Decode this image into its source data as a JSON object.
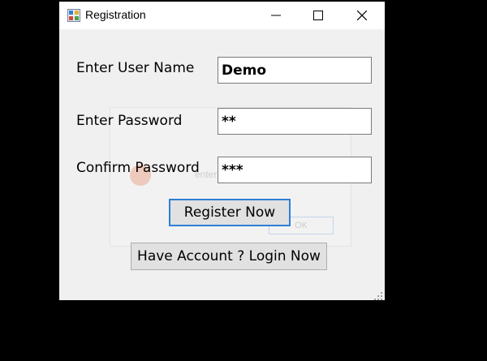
{
  "window": {
    "title": "Registration",
    "app_icon": "form-app-icon"
  },
  "titlebar_buttons": {
    "minimize_icon": "minimize-icon",
    "maximize_icon": "maximize-icon",
    "close_icon": "close-icon"
  },
  "form": {
    "username": {
      "label": "Enter User Name",
      "value": "Demo"
    },
    "password": {
      "label": "Enter Password",
      "value": "**"
    },
    "confirm_password": {
      "label": "Confirm Password",
      "value": "***"
    }
  },
  "buttons": {
    "register": "Register Now",
    "login": "Have Account ? Login Now"
  },
  "background_dialog": {
    "message": "enter both password same",
    "ok_label": "OK"
  },
  "colors": {
    "window_bg": "#f0f0f0",
    "titlebar_bg": "#ffffff",
    "focus_border": "#2e7fd6"
  }
}
